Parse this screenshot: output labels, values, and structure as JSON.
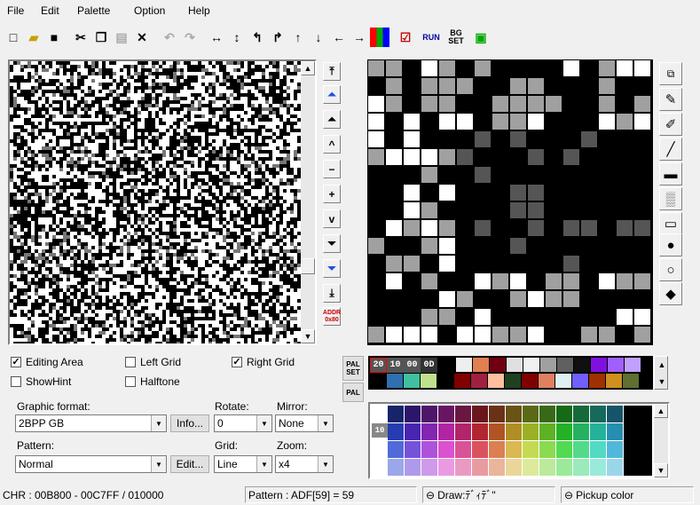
{
  "menu": [
    "File",
    "Edit",
    "Palette",
    "Option",
    "Help"
  ],
  "toolbar": {
    "icons": [
      "new-file",
      "open-folder",
      "save-disk",
      "cut-scissors",
      "copy",
      "paste",
      "delete-x",
      "undo",
      "redo",
      "flip-horizontal",
      "flip-vertical",
      "rotate-left",
      "rotate-right",
      "shift-up",
      "shift-down",
      "shift-left",
      "shift-right",
      "color-swap",
      "check-tool",
      "run",
      "bg-set",
      "palette-tool"
    ],
    "run_label": "RUN",
    "bg_label": "BG\nSET"
  },
  "nav": {
    "addr_label": "ADDR",
    "addr_value": "0x80"
  },
  "options": {
    "editing_area": {
      "label": "Editing Area",
      "checked": true
    },
    "left_grid": {
      "label": "Left Grid",
      "checked": false
    },
    "right_grid": {
      "label": "Right Grid",
      "checked": true
    },
    "show_hint": {
      "label": "ShowHint",
      "checked": false
    },
    "halftone": {
      "label": "Halftone",
      "checked": false
    }
  },
  "graphic_format": {
    "label": "Graphic format:",
    "value": "2BPP GB",
    "info_button": "Info..."
  },
  "rotate": {
    "label": "Rotate:",
    "value": "0"
  },
  "mirror": {
    "label": "Mirror:",
    "value": "None"
  },
  "pattern": {
    "label": "Pattern:",
    "value": "Normal",
    "edit_button": "Edit..."
  },
  "grid": {
    "label": "Grid:",
    "value": "Line"
  },
  "zoom": {
    "label": "Zoom:",
    "value": "x4"
  },
  "palette": {
    "pal_set_label": "PAL\nSET",
    "pal_label": "PAL",
    "selected": [
      "20",
      "10",
      "00",
      "0D"
    ],
    "row1": [
      "#000000",
      "#eeeeee",
      "#e08050",
      "#700010",
      "#e0e0e0",
      "#f0f0f0",
      "#a0a0a0",
      "#606060",
      "#101010",
      "#8010e0",
      "#a060ff",
      "#c0a0ff"
    ],
    "row2": [
      "#000000",
      "#3070b0",
      "#40c0a0",
      "#c0e090",
      "#000000",
      "#800000",
      "#a02040",
      "#ffc0a0",
      "#204020",
      "#800000",
      "#e08060",
      "#e0f0f0",
      "#7060ff",
      "#a03000",
      "#d09020",
      "#607030"
    ],
    "page_label": "10"
  },
  "status": {
    "chr": "CHR : 00B800 - 00C7FF / 010000",
    "pattern": "Pattern : ADF[59] = 59",
    "draw": "Draw:ﾃﾞｨﾃﾞ\"",
    "pickup": "Pickup color"
  }
}
